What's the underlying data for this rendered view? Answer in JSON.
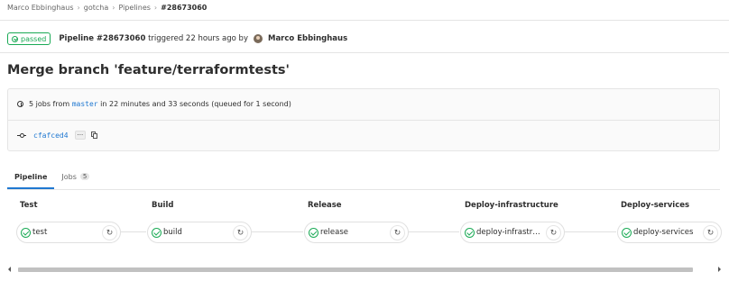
{
  "breadcrumb": [
    "Marco Ebbinghaus",
    "gotcha",
    "Pipelines",
    "#28673060"
  ],
  "header": {
    "status": "passed",
    "pipeline_label": "Pipeline #28673060",
    "triggered": "triggered 22 hours ago by",
    "author": "Marco Ebbinghaus"
  },
  "title": "Merge branch 'feature/terraformtests'",
  "info": {
    "jobs_prefix": "5 jobs from",
    "branch": "master",
    "jobs_suffix": "in 22 minutes and 33 seconds (queued for 1 second)",
    "commit": "cfafced4",
    "ellipsis": "···"
  },
  "tabs": [
    {
      "label": "Pipeline",
      "active": true
    },
    {
      "label": "Jobs",
      "count": "5",
      "active": false
    }
  ],
  "stages": [
    {
      "name": "Test",
      "job": "test"
    },
    {
      "name": "Build",
      "job": "build"
    },
    {
      "name": "Release",
      "job": "release"
    },
    {
      "name": "Deploy-infrastructure",
      "job": "deploy-infrastr…"
    },
    {
      "name": "Deploy-services",
      "job": "deploy-services"
    }
  ],
  "icons": {
    "status": "check-circle-icon",
    "retry": "retry-icon",
    "clock": "clock-icon",
    "commit": "commit-icon",
    "copy": "copy-icon"
  },
  "colors": {
    "success": "#1aaa55",
    "link": "#1f78d1"
  }
}
